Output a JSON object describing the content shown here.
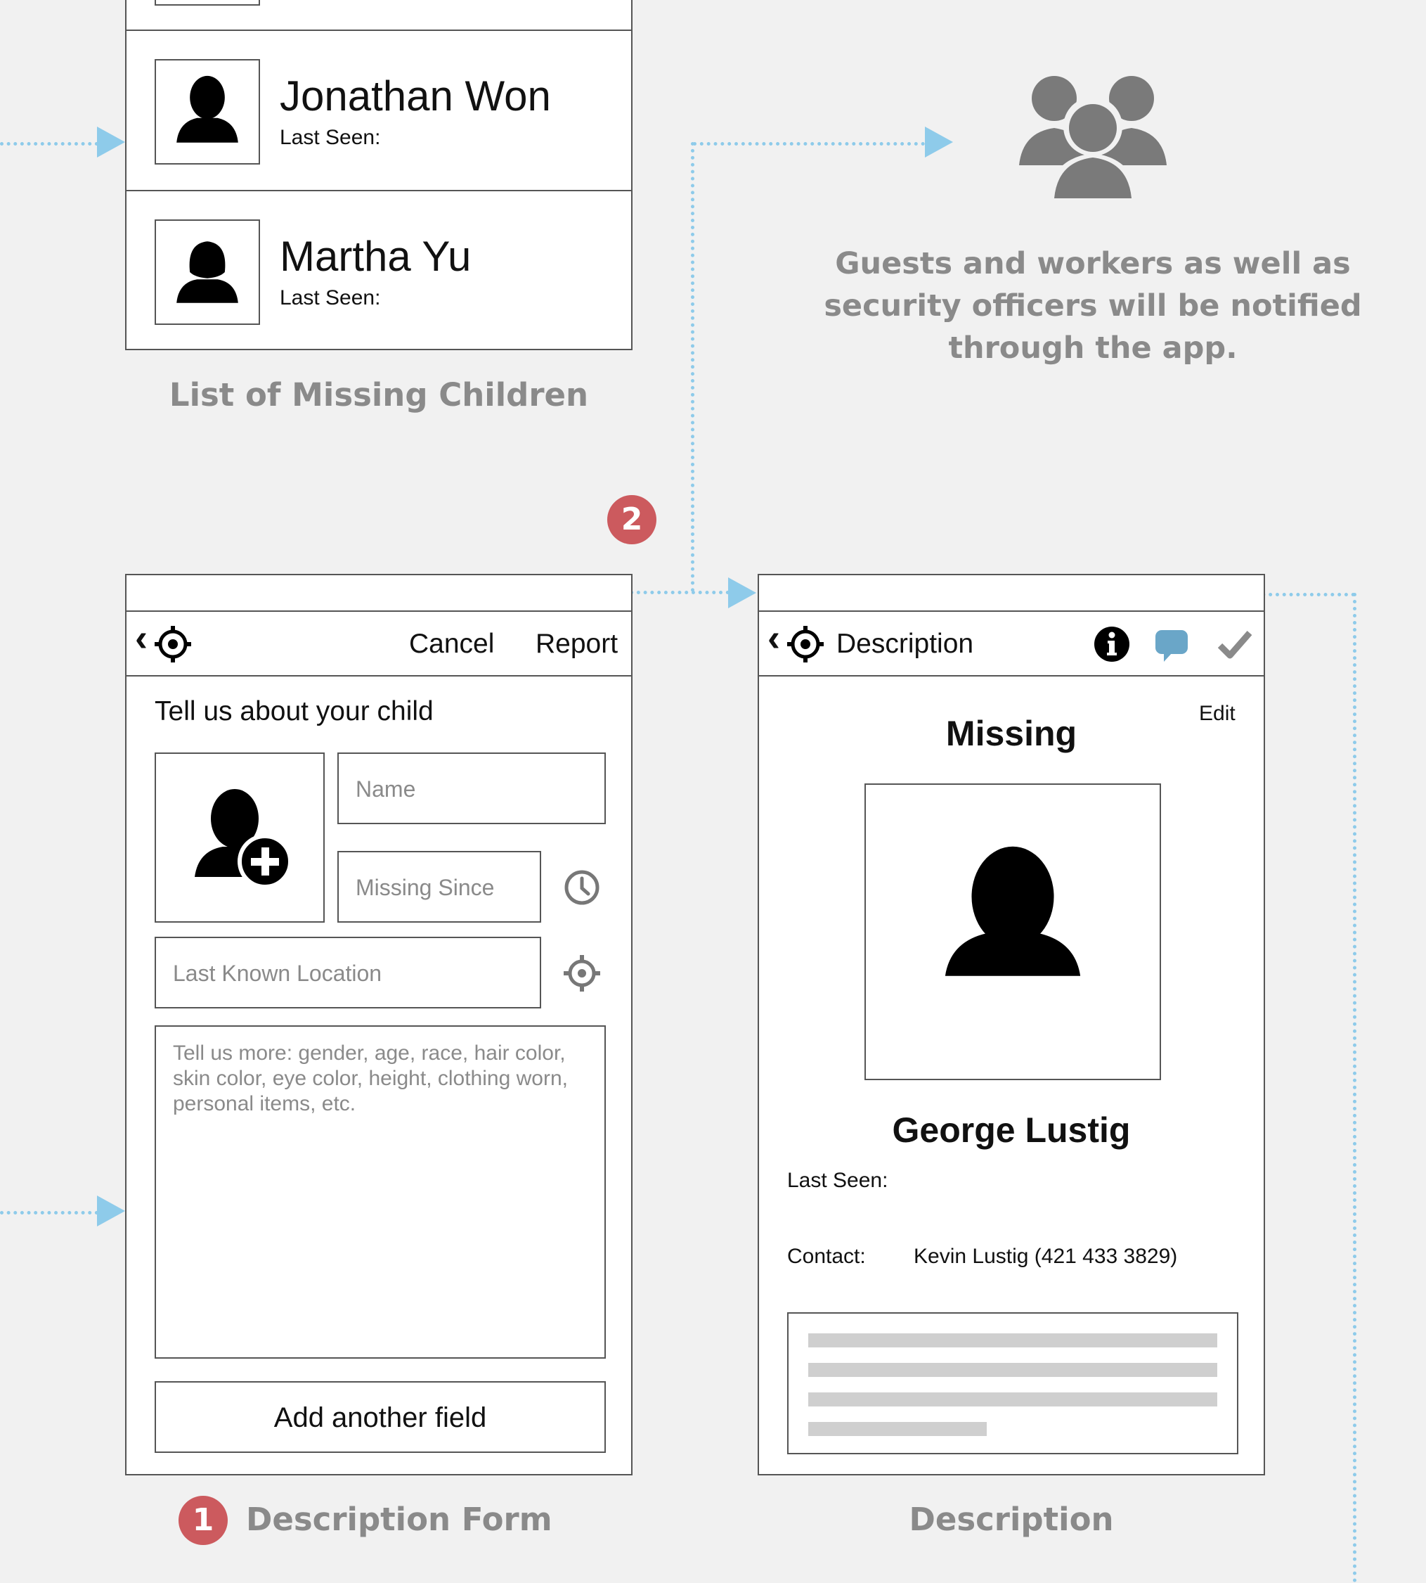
{
  "list_screen": {
    "caption": "List of Missing Children",
    "items": [
      {
        "name": "Jonathan Won",
        "last_seen_label": "Last Seen:"
      },
      {
        "name": "Martha Yu",
        "last_seen_label": "Last Seen:"
      }
    ]
  },
  "notification": {
    "text_line1": "Guests and workers as well as",
    "text_line2": "security officers will be notified",
    "text_line3": "through the app."
  },
  "badges": {
    "step1": "1",
    "step2": "2"
  },
  "form_screen": {
    "caption": "Description Form",
    "toolbar": {
      "back": "‹",
      "cancel": "Cancel",
      "report": "Report"
    },
    "heading": "Tell us about your child",
    "name_placeholder": "Name",
    "missing_since_placeholder": "Missing Since",
    "location_placeholder": "Last Known Location",
    "details_line1": "Tell us more: gender, age, race, hair color,",
    "details_line2": "skin color, eye color, height, clothing worn,",
    "details_line3": "personal items, etc.",
    "add_field": "Add another field"
  },
  "description_screen": {
    "caption": "Description",
    "toolbar": {
      "back": "‹",
      "title": "Description"
    },
    "edit": "Edit",
    "status": "Missing",
    "child_name": "George Lustig",
    "last_seen_label": "Last Seen:",
    "contact_label": "Contact:",
    "contact_value": "Kevin Lustig (421 433 3829)"
  },
  "colors": {
    "connector": "#8ecbea",
    "badge": "#cc5a5e",
    "caption": "#8a8a8a",
    "chat_icon": "#6aa6c8"
  }
}
